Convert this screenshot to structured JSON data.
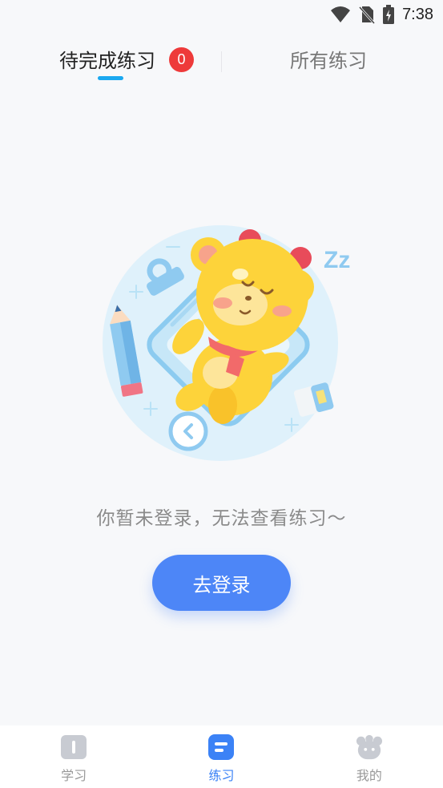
{
  "status_bar": {
    "time": "7:38",
    "icons": [
      "wifi-icon",
      "no-sim-icon",
      "battery-charging-icon"
    ]
  },
  "tabs": {
    "pending_label": "待完成练习",
    "pending_count": "0",
    "all_label": "所有练习",
    "active_tab": "pending",
    "indicator_color": "#1aa8f0",
    "badge_color": "#ee3a3a"
  },
  "illustration": {
    "zz_text": "Zz",
    "mascot": "sleeping-yellow-lion-mascot"
  },
  "empty_state": {
    "message": "你暂未登录，无法查看练习～",
    "login_button": "去登录",
    "button_color": "#4d86f7"
  },
  "bottom_nav": {
    "items": [
      {
        "label": "学习",
        "icon": "book-icon",
        "active": false
      },
      {
        "label": "练习",
        "icon": "practice-doc-icon",
        "active": true
      },
      {
        "label": "我的",
        "icon": "bear-face-icon",
        "active": false
      }
    ],
    "active_color": "#3b82f6"
  }
}
